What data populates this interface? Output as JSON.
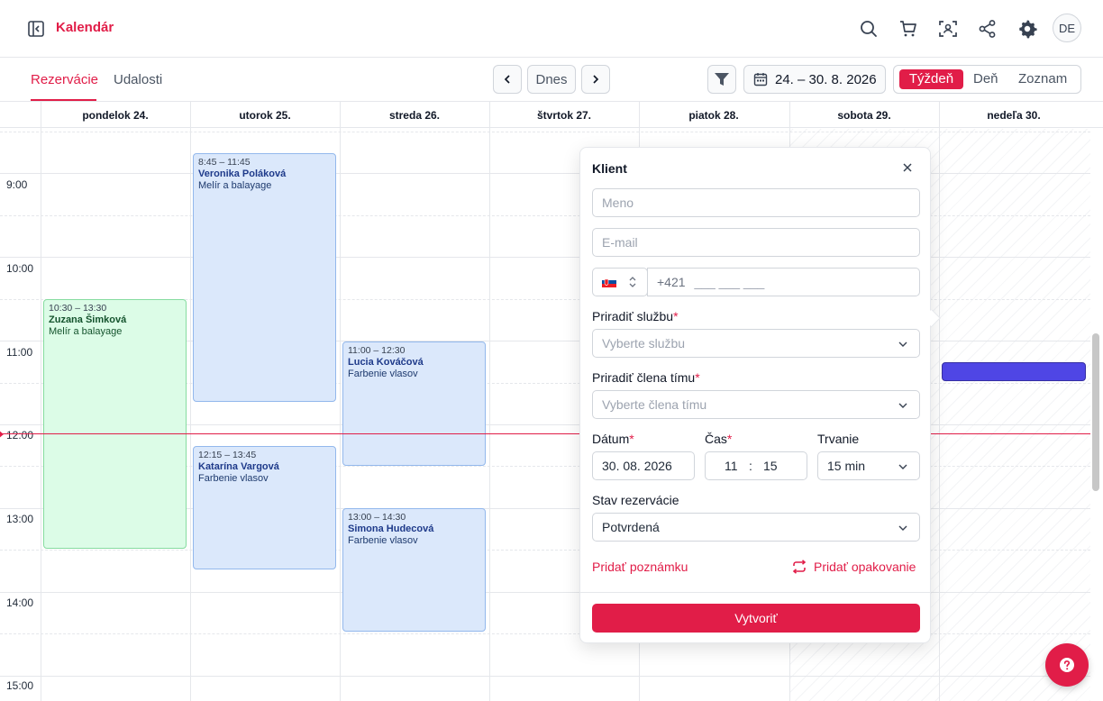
{
  "app": {
    "title": "Kalendár",
    "avatar": "DE"
  },
  "tabs": [
    {
      "label": "Rezervácie"
    },
    {
      "label": "Udalosti"
    }
  ],
  "nav": {
    "today": "Dnes",
    "date_range": "24. – 30. 8. 2026"
  },
  "views": [
    "Týždeň",
    "Deň",
    "Zoznam"
  ],
  "days": [
    "pondelok 24.",
    "utorok 25.",
    "streda 26.",
    "štvrtok 27.",
    "piatok 28.",
    "sobota 29.",
    "nedeľa 30."
  ],
  "hours": [
    "9:00",
    "10:00",
    "11:00",
    "12:00",
    "13:00",
    "14:00",
    "15:00"
  ],
  "events": [
    {
      "time": "8:45 – 11:45",
      "name": "Veronika Poláková",
      "service": "Melír a balayage"
    },
    {
      "time": "10:30 – 13:30",
      "name": "Zuzana Šimková",
      "service": "Melír a balayage"
    },
    {
      "time": "11:00 – 12:30",
      "name": "Lucia Kováčová",
      "service": "Farbenie vlasov"
    },
    {
      "time": "12:15 – 13:45",
      "name": "Katarína Vargová",
      "service": "Farbenie vlasov"
    },
    {
      "time": "13:00 – 14:30",
      "name": "Simona Hudecová",
      "service": "Farbenie vlasov"
    }
  ],
  "popup": {
    "title": "Klient",
    "name_placeholder": "Meno",
    "email_placeholder": "E-mail",
    "phone_prefix": "+421",
    "phone_mask": "___ ___ ___",
    "service_label": "Priradiť službu",
    "service_placeholder": "Vyberte službu",
    "member_label": "Priradiť člena tímu",
    "member_placeholder": "Vyberte člena tímu",
    "date_label": "Dátum",
    "date_value": "30. 08. 2026",
    "time_label": "Čas",
    "time_hour": "11",
    "time_sep": ":",
    "time_min": "15",
    "duration_label": "Trvanie",
    "duration_value": "15 min",
    "status_label": "Stav rezervácie",
    "status_value": "Potvrdená",
    "add_note": "Pridať poznámku",
    "add_repeat": "Pridať opakovanie",
    "create": "Vytvoriť",
    "required_mark": "*"
  },
  "colors": {
    "accent": "#e11d48",
    "event_blue": "#dbe8fb",
    "event_green": "#dcfce7",
    "block_purple": "#4f46e5"
  },
  "icons": {
    "sidebar_toggle": "collapse-sidebar-icon",
    "top": [
      "search-icon",
      "cart-icon",
      "scan-icon",
      "share-icon",
      "gear-icon"
    ],
    "help": "question-icon"
  }
}
